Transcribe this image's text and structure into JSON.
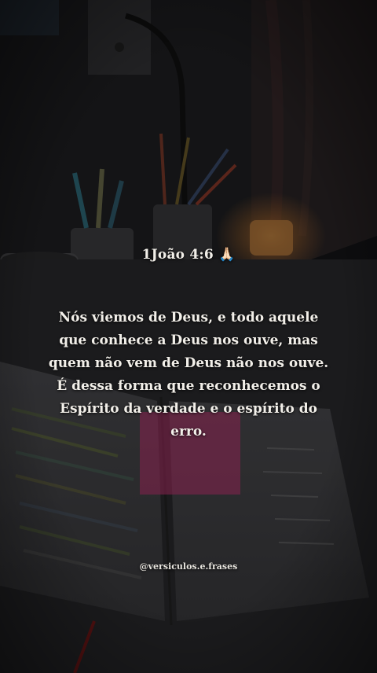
{
  "post": {
    "reference": "1João 4:6 🙏🏻",
    "verse": "Nós viemos de Deus, e todo aquele que conhece a Deus nos ouve, mas quem não vem de Deus não nos ouve. É dessa forma que reconhecemos o Espírito da verdade e o espírito do erro.",
    "handle": "@versiculos.e.frases"
  },
  "colors": {
    "text": "#f2efe9",
    "candle_glow": "#e8a24a",
    "sticky_note": "#d2357a"
  }
}
